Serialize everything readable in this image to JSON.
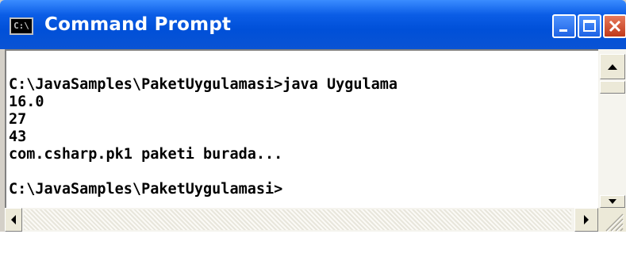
{
  "window": {
    "title": "Command Prompt",
    "app_icon_text": "C:\\"
  },
  "titlebar_buttons": [
    {
      "name": "minimize-button",
      "glyph": "minimize-icon"
    },
    {
      "name": "maximize-button",
      "glyph": "maximize-icon"
    },
    {
      "name": "close-button",
      "glyph": "close-icon"
    }
  ],
  "console": {
    "lines": [
      "",
      "C:\\JavaSamples\\PaketUygulamasi>java Uygulama",
      "16.0",
      "27",
      "43",
      "com.csharp.pk1 paketi burada...",
      "",
      "C:\\JavaSamples\\PaketUygulamasi>"
    ]
  },
  "colors": {
    "titlebar": "#0050d8",
    "title_text": "#ffffff",
    "console_bg": "#ffffff",
    "console_text": "#000000",
    "chrome": "#d4d0c8"
  }
}
